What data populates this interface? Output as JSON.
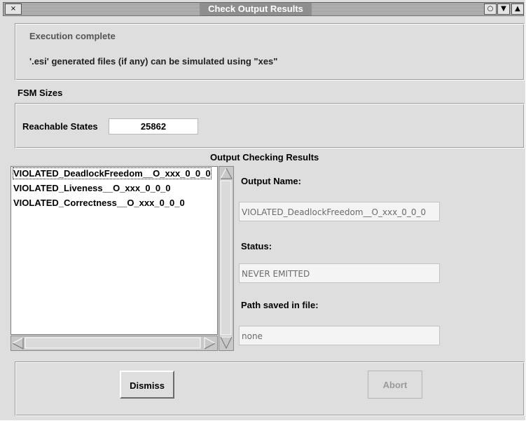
{
  "window": {
    "title": "Check Output Results",
    "close_glyph": "×",
    "controls": [
      "○",
      "▼",
      "▲"
    ]
  },
  "messages": {
    "line1": "Execution complete",
    "line2": "'.esi' generated files (if any) can be simulated using \"xes\""
  },
  "fsm": {
    "section_title": "FSM Sizes",
    "reachable_label": "Reachable States",
    "reachable_value": "25862"
  },
  "results": {
    "section_title": "Output Checking Results",
    "items": [
      "VIOLATED_DeadlockFreedom__O_xxx_0_0_0",
      "VIOLATED_Liveness__O_xxx_0_0_0",
      "VIOLATED_Correctness__O_xxx_0_0_0"
    ],
    "selected_index": 0
  },
  "details": {
    "output_name_label": "Output Name:",
    "output_name_value": "VIOLATED_DeadlockFreedom__O_xxx_0_0_0",
    "status_label": "Status:",
    "status_value": "NEVER EMITTED",
    "path_label": "Path saved in file:",
    "path_value": "none"
  },
  "buttons": {
    "dismiss": "Dismiss",
    "abort": "Abort"
  },
  "colors": {
    "window_bg": "#dedede",
    "titlebar_bg": "#9a9a9a",
    "disabled_text": "#9a9a9a"
  }
}
